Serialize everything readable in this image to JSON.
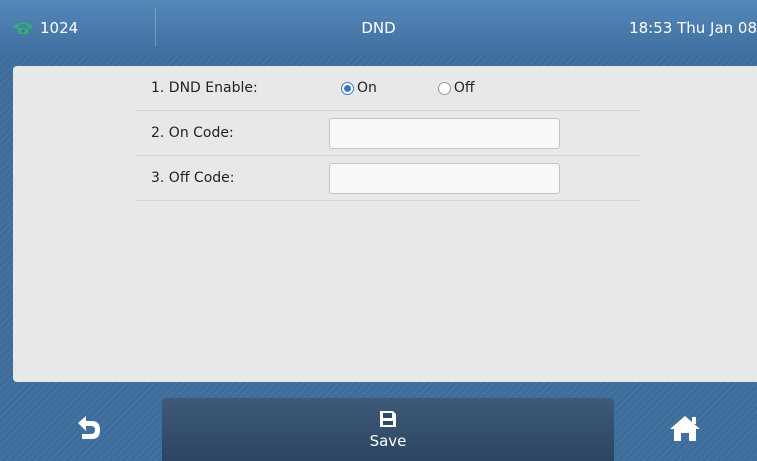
{
  "status_bar": {
    "account": "1024",
    "title": "DND",
    "datetime": "18:53 Thu Jan 08"
  },
  "form": {
    "rows": [
      {
        "label": "1. DND Enable:",
        "type": "radio",
        "options": [
          {
            "label": "On",
            "selected": true
          },
          {
            "label": "Off",
            "selected": false
          }
        ]
      },
      {
        "label": "2. On Code:",
        "type": "text",
        "value": ""
      },
      {
        "label": "3. Off Code:",
        "type": "text",
        "value": ""
      }
    ]
  },
  "softkeys": {
    "back_icon": "back-arrow-icon",
    "save_label": "Save",
    "save_icon": "floppy-disk-icon",
    "home_icon": "home-icon"
  },
  "colors": {
    "background": "#3e6d9c",
    "panel": "#e8e8e8",
    "softkey_center": "#2f4a68",
    "radio_accent": "#3c79c4",
    "phone_icon": "#2fb36b"
  }
}
